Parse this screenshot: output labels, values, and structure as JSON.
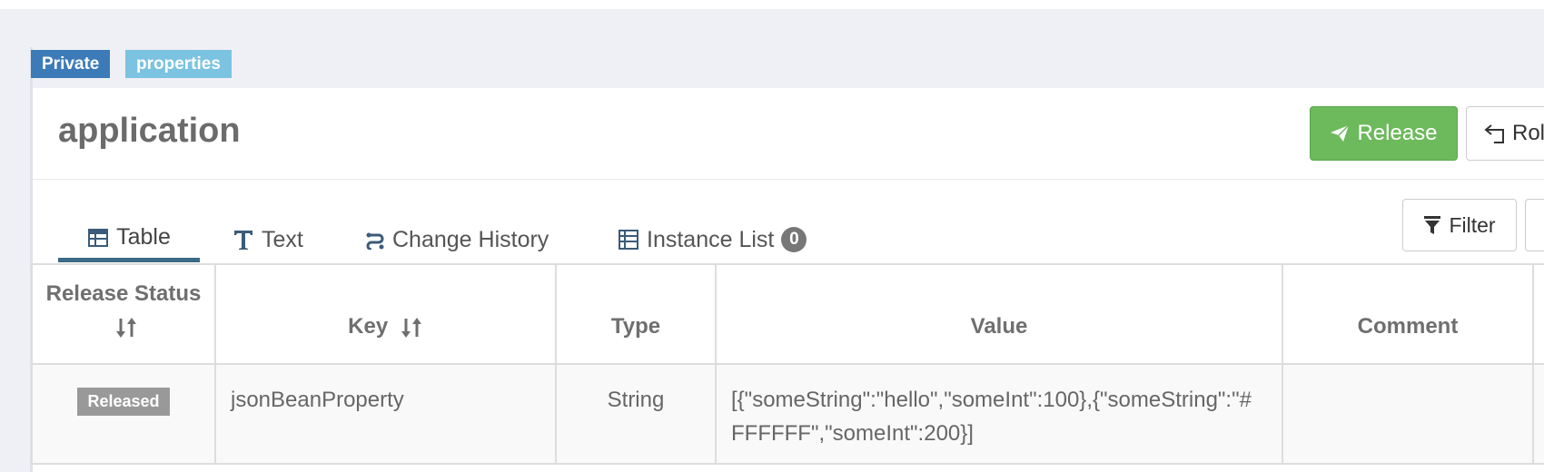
{
  "namespace": {
    "labels": [
      "Private",
      "properties"
    ],
    "title": "application"
  },
  "actions": {
    "release": "Release",
    "rollback": "Rol"
  },
  "tabs": [
    {
      "label": "Table",
      "icon": "table-icon"
    },
    {
      "label": "Text",
      "icon": "text-icon"
    },
    {
      "label": "Change History",
      "icon": "history-icon"
    },
    {
      "label": "Instance List",
      "icon": "instance-list-icon",
      "count": "0"
    }
  ],
  "toolbar": {
    "filter": "Filter"
  },
  "table": {
    "headers": [
      "Release Status",
      "Key",
      "Type",
      "Value",
      "Comment"
    ],
    "rows": [
      {
        "status": "Released",
        "key": "jsonBeanProperty",
        "type": "String",
        "value": "[{\"someString\":\"hello\",\"someInt\":100},{\"someString\":\"#FFFFFF\",\"someInt\":200}]",
        "comment": ""
      }
    ]
  },
  "colors": {
    "release_button": "#6cba5c",
    "label_private": "#3d7bb8",
    "label_properties": "#7bc3e1",
    "active_tab_underline": "#3b6b86"
  }
}
